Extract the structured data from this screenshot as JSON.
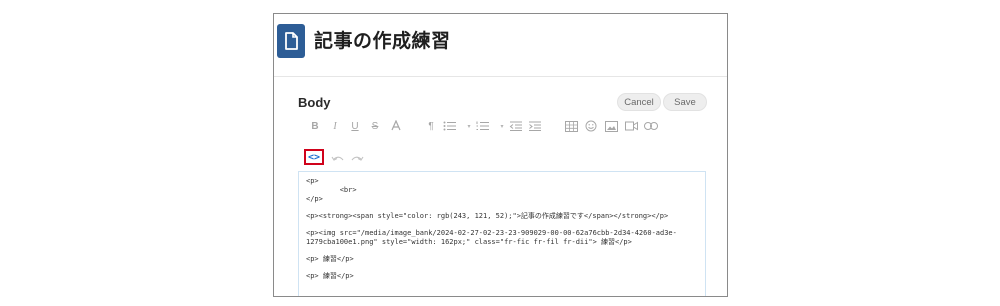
{
  "page": {
    "title": "記事の作成練習"
  },
  "field": {
    "label": "Body"
  },
  "buttons": {
    "cancel": "Cancel",
    "save": "Save"
  },
  "toolbar": {
    "items": [
      "bold-icon",
      "italic-icon",
      "underline-icon",
      "strikethrough-icon",
      "text-color-icon",
      "paragraph-format-icon",
      "unordered-list-icon",
      "ordered-list-icon",
      "outdent-icon",
      "indent-icon",
      "insert-table-icon",
      "emoticon-icon",
      "insert-image-icon",
      "insert-video-icon",
      "insert-link-icon"
    ],
    "code_view_label": "<>",
    "undo_icon": "undo-icon",
    "redo_icon": "redo-icon"
  },
  "editor": {
    "lines": [
      "<p>",
      "        <br>",
      "</p>",
      "<p><strong><span style=\"color: rgb(243, 121, 52);\">記事の作成練習です</span></strong></p>",
      "<p><img src=\"/media/image_bank/2024-02-27-02-23-23-909029-00-00-62a76cbb-2d34-4260-ad3e-",
      "1279cba100e1.png\" style=\"width: 162px;\" class=\"fr-fic fr-fil fr-dii\"> 練習</p>",
      "<p> 練習</p>",
      "<p> 練習</p>"
    ]
  },
  "colors": {
    "icon_bg": "#2d5d96",
    "highlight_border": "#d0021b",
    "code_view_icon": "#1c6fd1"
  }
}
